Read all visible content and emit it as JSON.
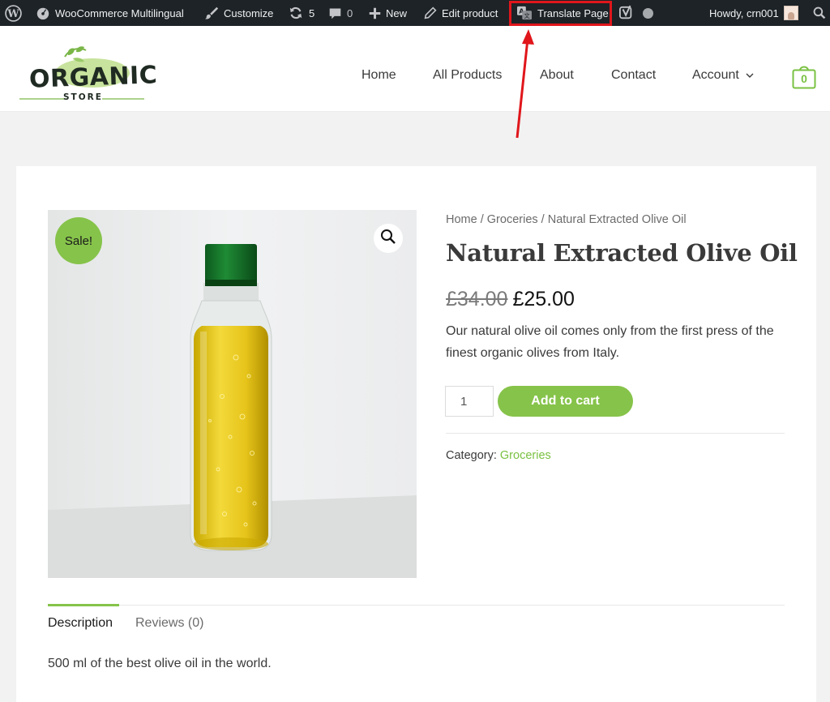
{
  "adminbar": {
    "site_name": "WooCommerce Multilingual",
    "customize": "Customize",
    "updates_count": "5",
    "comments_count": "0",
    "new_label": "New",
    "edit_product": "Edit product",
    "translate_page": "Translate Page",
    "howdy": "Howdy, crn001"
  },
  "header": {
    "logo_main": "ORGANIC",
    "logo_sub": "STORE",
    "nav": [
      "Home",
      "All Products",
      "About",
      "Contact",
      "Account"
    ],
    "cart_count": "0"
  },
  "product": {
    "sale_badge": "Sale!",
    "breadcrumb": [
      "Home",
      "Groceries",
      "Natural Extracted Olive Oil"
    ],
    "breadcrumb_sep": " / ",
    "title": "Natural Extracted Olive Oil",
    "old_price": "£34.00",
    "new_price": "£25.00",
    "short_description": "Our natural olive oil comes only from the first press of the finest organic olives from Italy.",
    "quantity": "1",
    "add_to_cart": "Add to cart",
    "category_label": "Category:",
    "category": "Groceries"
  },
  "tabs": {
    "description": "Description",
    "reviews": "Reviews (0)",
    "description_text": "500 ml of the best olive oil in the world."
  },
  "colors": {
    "accent": "#86c34a",
    "link": "#7ac142",
    "adminbar": "#1d2327",
    "highlight": "#e0161b"
  },
  "icons": [
    "wordpress-icon",
    "dashboard-icon",
    "brush-icon",
    "refresh-icon",
    "comment-icon",
    "plus-icon",
    "pencil-icon",
    "translate-icon",
    "yoast-icon",
    "status-dot-icon",
    "search-icon",
    "chevron-down-icon",
    "shopping-bag-icon",
    "magnifier-icon"
  ]
}
